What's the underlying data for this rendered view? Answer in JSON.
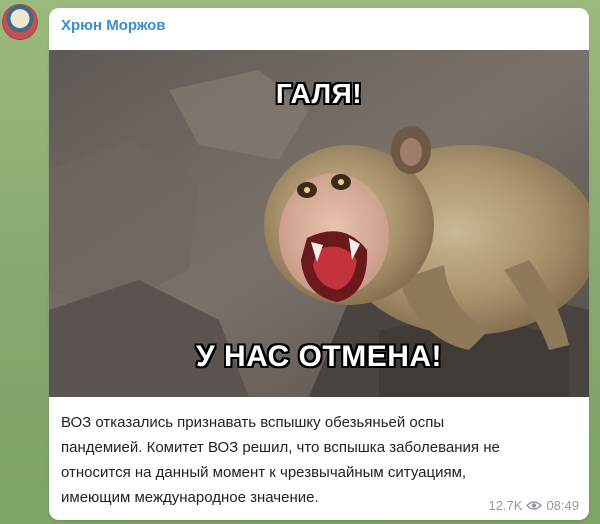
{
  "channel": {
    "sender_name": "Хрюн Моржов"
  },
  "post": {
    "image": {
      "caption_top": "ГАЛЯ!",
      "caption_bottom": "У НАС ОТМЕНА!"
    },
    "text_lines": [
      "ВОЗ отказались признавать вспышку обезьяньей оспы",
      "пандемией. Комитет ВОЗ решил, что вспышка заболевания не",
      "относится на данный момент к чрезвычайным ситуациям,",
      "имеющим международное значение."
    ],
    "views": "12.7K",
    "time": "08:49"
  },
  "icons": {
    "views": "eye-icon"
  },
  "colors": {
    "sender": "#3a8ccf",
    "meta": "#8c9aa6",
    "bubble": "#ffffff",
    "wallpaper": "#8fae74"
  }
}
